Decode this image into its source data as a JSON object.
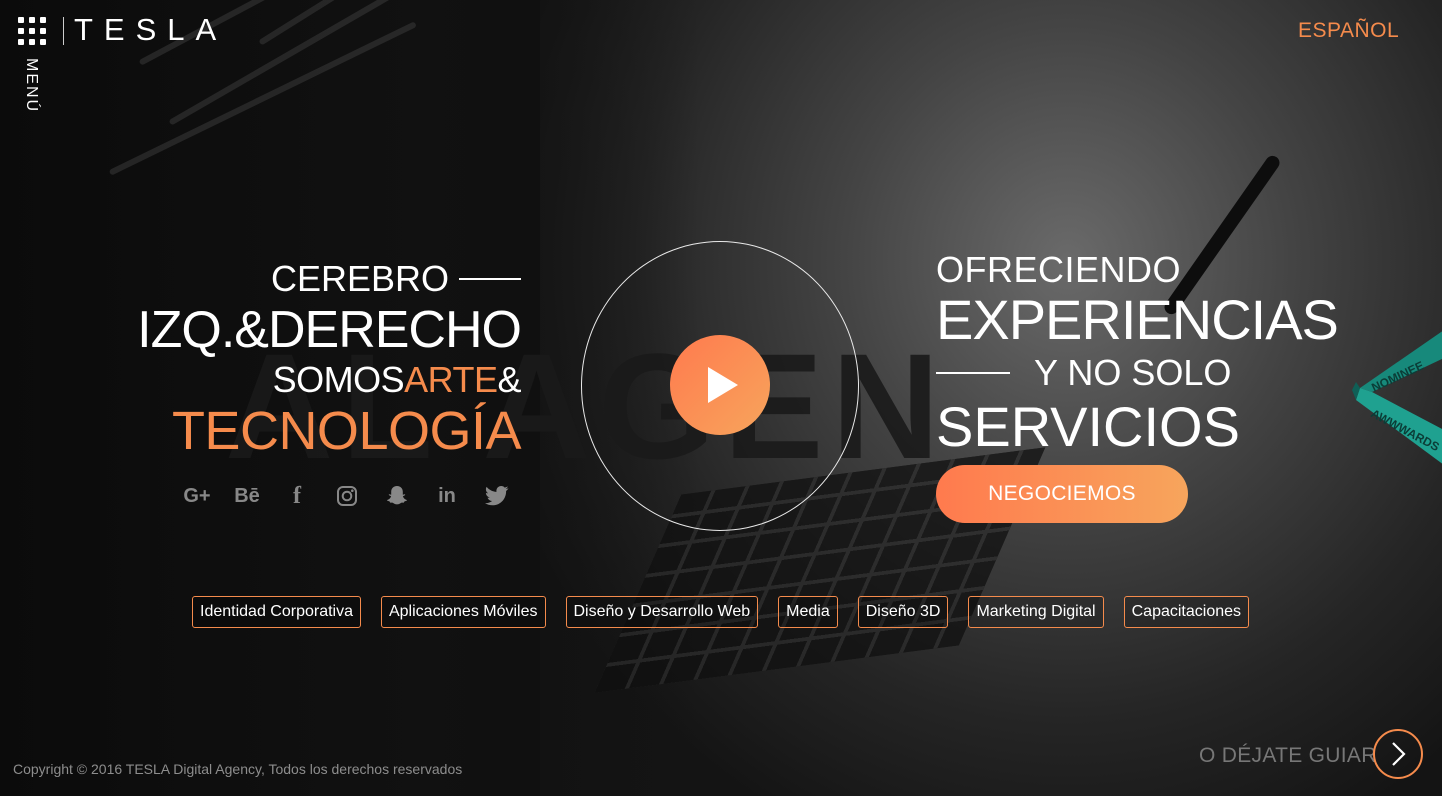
{
  "header": {
    "logo": "TESLA",
    "menu_label": "MENÚ",
    "language": "ESPAÑOL"
  },
  "hero_left": {
    "line1": "CEREBRO",
    "line2": "IZQ.&DERECHO",
    "line3_a": "SOMOS",
    "line3_b": "ARTE",
    "line3_c": "&",
    "line4": "TECNOLOGÍA"
  },
  "social": [
    {
      "icon": "google-plus-icon",
      "glyph": "G+"
    },
    {
      "icon": "behance-icon",
      "glyph": "Bē"
    },
    {
      "icon": "facebook-icon",
      "glyph": "f"
    },
    {
      "icon": "instagram-icon",
      "glyph": ""
    },
    {
      "icon": "snapchat-icon",
      "glyph": ""
    },
    {
      "icon": "linkedin-icon",
      "glyph": "in"
    },
    {
      "icon": "twitter-icon",
      "glyph": ""
    }
  ],
  "hero_right": {
    "line1": "OFRECIENDO",
    "line2": "EXPERIENCIAS",
    "line3": "Y NO SOLO",
    "line4": "SERVICIOS",
    "cta": "NEGOCIEMOS"
  },
  "services": [
    "Identidad Corporativa",
    "Aplicaciones Móviles",
    "Diseño y Desarrollo Web",
    "Media",
    "Diseño 3D",
    "Marketing Digital",
    "Capacitaciones"
  ],
  "ribbon": {
    "line1": "NOMINEE",
    "line2": "AWWWARDS"
  },
  "footer": {
    "copyright": "Copyright © 2016 TESLA Digital Agency, Todos los derechos reservados",
    "guide": "O DÉJATE GUIAR"
  },
  "colors": {
    "accent": "#f58b4c",
    "accent_gradient_start": "#ff7a4e",
    "accent_gradient_end": "#f7a55c",
    "ribbon": "#1a8a7e"
  }
}
